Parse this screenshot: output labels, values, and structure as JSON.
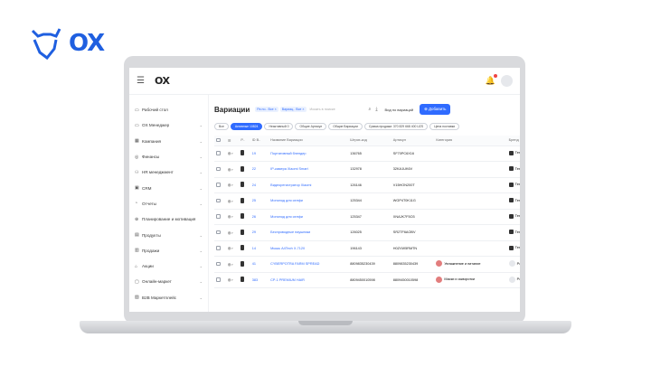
{
  "brand": {
    "logo_text": "OX"
  },
  "app": {
    "logo_text": "OX"
  },
  "sidebar": {
    "items": [
      {
        "label": "Рабочий стол",
        "icon": "desktop-icon",
        "chevron": false
      },
      {
        "label": "OX Менеджер",
        "icon": "monitor-icon",
        "chevron": true
      },
      {
        "label": "Компания",
        "icon": "building-icon",
        "chevron": true
      },
      {
        "label": "Финансы",
        "icon": "coin-icon",
        "chevron": true
      },
      {
        "label": "HR менеджмент",
        "icon": "people-icon",
        "chevron": true
      },
      {
        "label": "CRM",
        "icon": "crm-icon",
        "chevron": true
      },
      {
        "label": "Отчеты",
        "icon": "report-icon",
        "chevron": true
      },
      {
        "label": "Планирование и мотивация",
        "icon": "target-icon",
        "chevron": false
      },
      {
        "label": "Продукты",
        "icon": "box-icon",
        "chevron": true
      },
      {
        "label": "Продажи",
        "icon": "sales-icon",
        "chevron": true
      },
      {
        "label": "Акции",
        "icon": "tag-icon",
        "chevron": true
      },
      {
        "label": "Онлайн-маркет",
        "icon": "market-icon",
        "chevron": true
      },
      {
        "label": "B2B Маркетплейс",
        "icon": "b2b-icon",
        "chevron": true
      }
    ]
  },
  "toolbar": {
    "title": "Вариации",
    "chips": [
      "Ра по.. Все ×",
      "Вариац.. Все ×"
    ],
    "search_placeholder": "Искать в поиске",
    "view_mode": "Вид по вариаций",
    "add_label": "⊕ Добавить"
  },
  "filters": [
    "Все",
    "Активные 10824",
    "Неактивный 0",
    "Общие Артикул",
    "Общие Вариации",
    "Сумма продажи: 370 829 668 400 UZS",
    "Цена поставки"
  ],
  "table": {
    "headers": [
      "",
      "",
      "P..",
      "ID B..",
      "Название Вариации",
      "Штрих-код",
      "Артикул",
      "Категория",
      "Бренд"
    ],
    "rows": [
      {
        "id": "19",
        "name": "Портативный блендер",
        "barcode": "136765",
        "sku": "SF70PC6X16",
        "category": "",
        "brand": "Техно"
      },
      {
        "id": "22",
        "name": "IP-камера Xiaomi Smart",
        "barcode": "132978",
        "sku": "32KA1UK6V",
        "category": "",
        "brand": "Техно"
      },
      {
        "id": "24",
        "name": "Видеорегистратор Xiaomi",
        "barcode": "126146",
        "sku": "V15HON200T",
        "category": "",
        "brand": "Техно"
      },
      {
        "id": "25",
        "name": "Монопод для селфи",
        "barcode": "125344",
        "sku": "WGP4T0K11G",
        "category": "",
        "brand": "Техно"
      },
      {
        "id": "26",
        "name": "Монопод для селфи",
        "barcode": "125347",
        "sku": "XNAJK7F5O3",
        "category": "",
        "brand": "Техно"
      },
      {
        "id": "29",
        "name": "Беспроводные наушники",
        "barcode": "126025",
        "sku": "SR2TF6AOBV",
        "category": "",
        "brand": "Техно"
      },
      {
        "id": "14",
        "name": "Мышь A4Tech X-7120",
        "barcode": "196143",
        "sku": "H0ZVW5RMTN",
        "category": "",
        "brand": "Техно"
      },
      {
        "id": "41",
        "name": "CYBERPOTRA FARM SPREAD",
        "barcode": "8809835230439",
        "sku": "8809835230439",
        "category": "Увлажнение и питание",
        "brand": "Podge"
      },
      {
        "id": "383",
        "name": "CP-1 PREMIUM HAIR",
        "barcode": "8809450010598",
        "sku": "8809450010598",
        "category": "Маски и сыворотки",
        "brand": "Podge"
      }
    ]
  }
}
